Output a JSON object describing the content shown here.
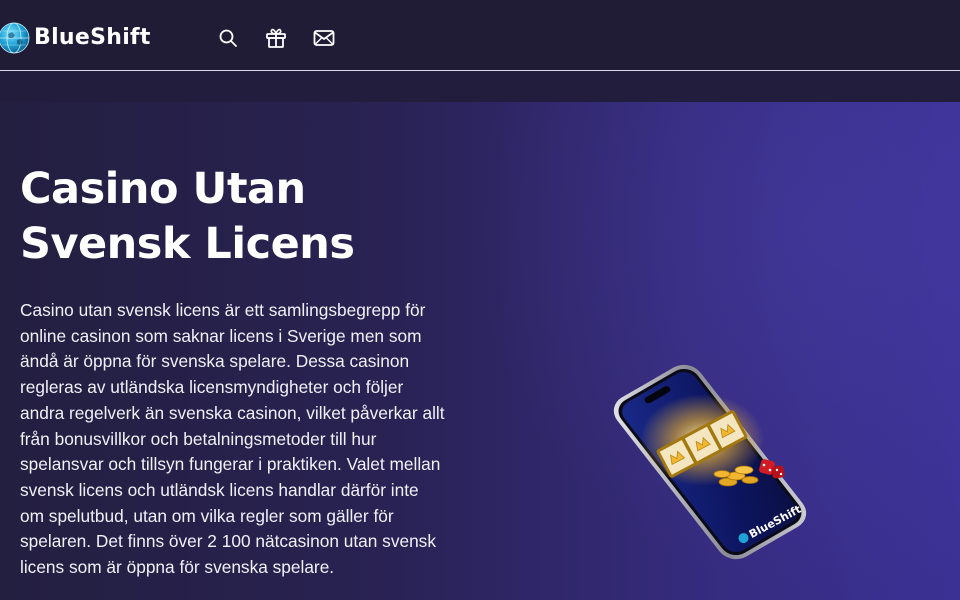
{
  "header": {
    "logo": {
      "text": "BlueShift",
      "icon": "globe-logo-icon"
    },
    "icons": [
      {
        "name": "search-icon",
        "label": "Search"
      },
      {
        "name": "gift-icon",
        "label": "Bonuses"
      },
      {
        "name": "mail-icon",
        "label": "Contact"
      }
    ]
  },
  "hero": {
    "title_line1": "Casino Utan",
    "title_line2": "Svensk Licens",
    "paragraph": "Casino utan svensk licens är ett samlingsbegrepp för online casinon som saknar licens i Sverige men som ändå är öppna för svenska spelare. Dessa casinon regleras av utländska licensmyndigheter och följer andra regelverk än svenska casinon, vilket påverkar allt från bonusvillkor och betalningsmetoder till hur spelansvar och tillsyn fungerar i praktiken. Valet mellan svensk licens och utländsk licens handlar därför inte om spelutbud, utan om vilka regler som gäller för spelaren. Det finns över 2 100 nätcasinon utan svensk licens som är öppna för svenska spelare.",
    "image": {
      "description_icon": "smartphone-slot-machine-illustration",
      "brand_text": "BlueShift"
    }
  },
  "colors": {
    "header_bg": "#201c36",
    "hero_bg_left": "#231f40",
    "hero_bg_right": "#3b3195",
    "accent_blue": "#1fa3d6",
    "gold": "#f2b632",
    "text": "#ffffff"
  }
}
